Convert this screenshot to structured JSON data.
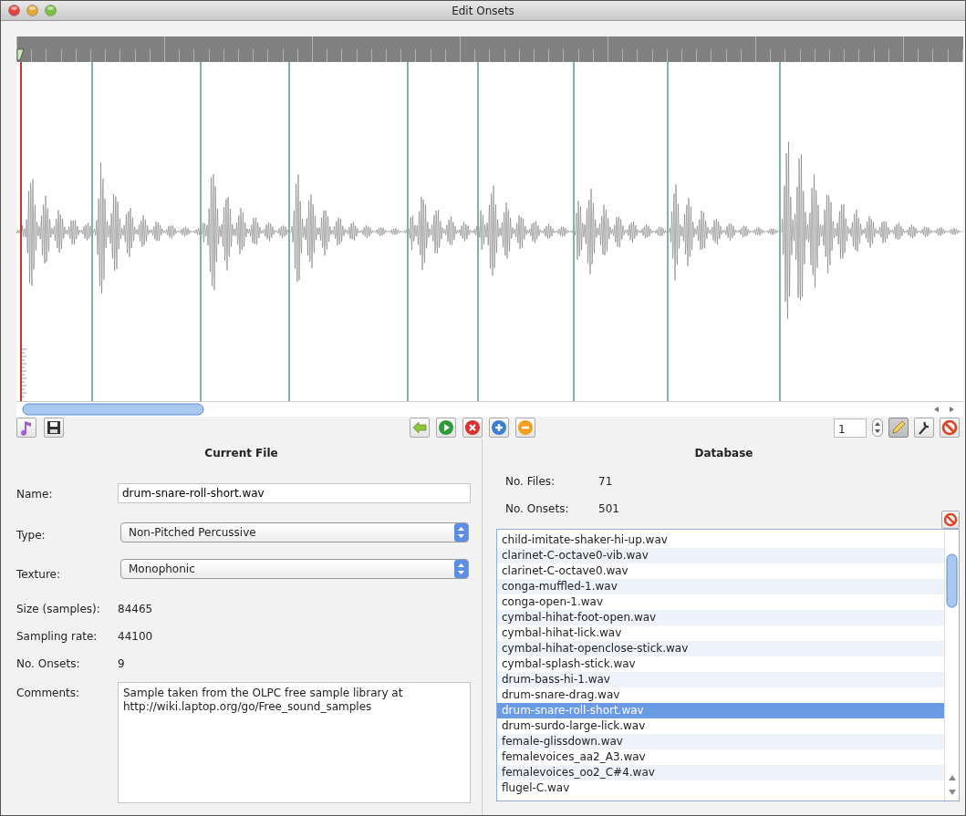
{
  "window": {
    "title": "Edit Onsets"
  },
  "toolbar": {
    "spinner": {
      "value": "1"
    },
    "tools": [
      {
        "kind": "pencil",
        "selected": true
      },
      {
        "kind": "wrench",
        "selected": false
      }
    ]
  },
  "current_file": {
    "title": "Current File",
    "fields": [
      {
        "kind": "input",
        "label": "Name:",
        "value": "drum-snare-roll-short.wav"
      },
      {
        "kind": "select",
        "label": "Type:",
        "value": "Non-Pitched Percussive"
      },
      {
        "kind": "select",
        "label": "Texture:",
        "value": "Monophonic"
      },
      {
        "kind": "text",
        "label": "Size (samples):",
        "value": "84465"
      },
      {
        "kind": "text",
        "label": "Sampling rate:",
        "value": "44100"
      },
      {
        "kind": "text",
        "label": "No. Onsets:",
        "value": "9"
      },
      {
        "kind": "textarea",
        "label": "Comments:",
        "value": "Sample taken from the OLPC free sample library at http://wiki.laptop.org/go/Free_sound_samples"
      }
    ]
  },
  "database": {
    "title": "Database",
    "stats": [
      {
        "label": "No. Files:",
        "value": "71"
      },
      {
        "label": "No. Onsets:",
        "value": "501"
      }
    ],
    "files": [
      {
        "name": "child-imitate-shaker-hi-up.wav",
        "selected": false
      },
      {
        "name": "clarinet-C-octave0-vib.wav",
        "selected": false
      },
      {
        "name": "clarinet-C-octave0.wav",
        "selected": false
      },
      {
        "name": "conga-muffled-1.wav",
        "selected": false
      },
      {
        "name": "conga-open-1.wav",
        "selected": false
      },
      {
        "name": "cymbal-hihat-foot-open.wav",
        "selected": false
      },
      {
        "name": "cymbal-hihat-lick.wav",
        "selected": false
      },
      {
        "name": "cymbal-hihat-openclose-stick.wav",
        "selected": false
      },
      {
        "name": "cymbal-splash-stick.wav",
        "selected": false
      },
      {
        "name": "drum-bass-hi-1.wav",
        "selected": false
      },
      {
        "name": "drum-snare-drag.wav",
        "selected": false
      },
      {
        "name": "drum-snare-roll-short.wav",
        "selected": true
      },
      {
        "name": "drum-surdo-large-lick.wav",
        "selected": false
      },
      {
        "name": "female-glissdown.wav",
        "selected": false
      },
      {
        "name": "femalevoices_aa2_A3.wav",
        "selected": false
      },
      {
        "name": "femalevoices_oo2_C#4.wav",
        "selected": false
      },
      {
        "name": "flugel-C.wav",
        "selected": false
      }
    ]
  }
}
